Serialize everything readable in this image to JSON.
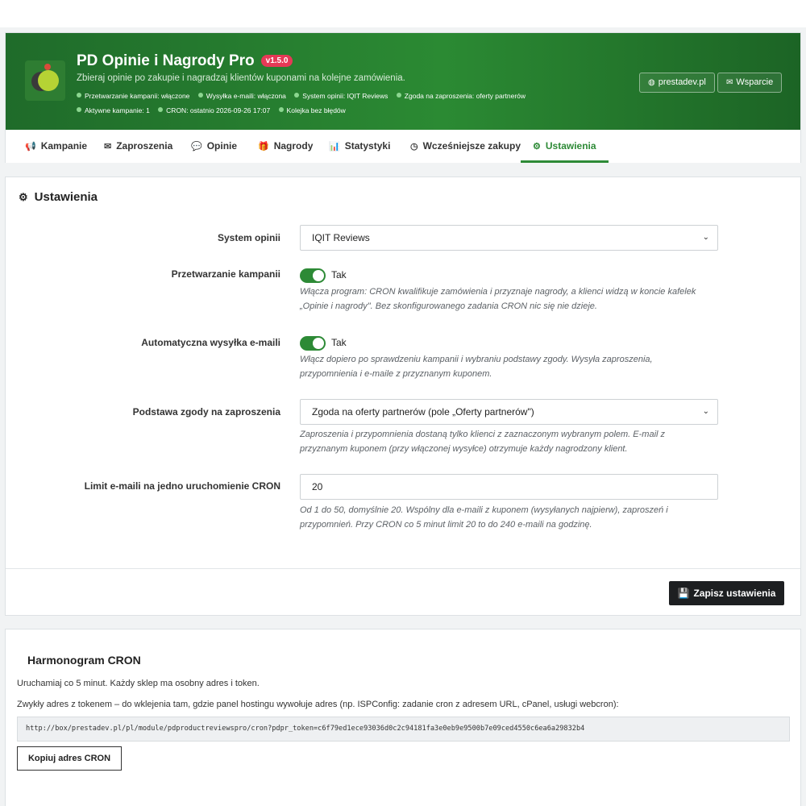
{
  "header": {
    "title": "PD Opinie i Nagrody Pro",
    "version": "v1.5.0",
    "subtitle": "Zbieraj opinie po zakupie i nagradzaj klientów kuponami na kolejne zamówienia.",
    "status_line1": [
      "Przetwarzanie kampanii: włączone",
      "Wysyłka e-maili: włączona",
      "System opinii: IQIT Reviews",
      "Zgoda na zaproszenia: oferty partnerów"
    ],
    "status_line2": [
      "Aktywne kampanie: 1",
      "CRON: ostatnio 2026-09-26 17:07",
      "Kolejka bez błędów"
    ],
    "site_button": "prestadev.pl",
    "support_button": "Wsparcie",
    "status_dot_color": "#8bd68f",
    "version_badge_color": "#e53956"
  },
  "tabs": [
    {
      "label": "Kampanie",
      "icon": "megaphone-icon"
    },
    {
      "label": "Zaproszenia",
      "icon": "envelope-icon"
    },
    {
      "label": "Opinie",
      "icon": "comments-icon"
    },
    {
      "label": "Nagrody",
      "icon": "gift-icon"
    },
    {
      "label": "Statystyki",
      "icon": "bar-chart-icon"
    },
    {
      "label": "Wcześniejsze zakupy",
      "icon": "history-icon"
    },
    {
      "label": "Ustawienia",
      "icon": "cogs-icon",
      "active": true
    }
  ],
  "settings": {
    "title": "Ustawienia",
    "review_system": {
      "label": "System opinii",
      "value": "IQIT Reviews"
    },
    "campaign_processing": {
      "label": "Przetwarzanie kampanii",
      "toggle": "Tak",
      "help_line1": "Włącza program: CRON kwalifikuje zamówienia i przyznaje nagrody, a klienci widzą w koncie kafelek",
      "help_line2": "„Opinie i nagrody\". Bez skonfigurowanego zadania CRON nic się nie dzieje."
    },
    "auto_email": {
      "label": "Automatyczna wysyłka e-maili",
      "toggle": "Tak",
      "help_line1": "Włącz dopiero po sprawdzeniu kampanii i wybraniu podstawy zgody. Wysyła zaproszenia,",
      "help_line2": "przypomnienia i e-maile z przyznanym kuponem."
    },
    "consent_basis": {
      "label": "Podstawa zgody na zaproszenia",
      "value": "Zgoda na oferty partnerów (pole „Oferty partnerów\")",
      "help_line1": "Zaproszenia i przypomnienia dostaną tylko klienci z zaznaczonym wybranym polem. E-mail z",
      "help_line2": "przyznanym kuponem (przy włączonej wysyłce) otrzymuje każdy nagrodzony klient."
    },
    "email_limit": {
      "label": "Limit e-maili na jedno uruchomienie CRON",
      "value": "20",
      "help_line1": "Od 1 do 50, domyślnie 20. Wspólny dla e-maili z kuponem (wysyłanych najpierw), zaproszeń i",
      "help_line2": "przypomnień. Przy CRON co 5 minut limit 20 to do 240 e-maili na godzinę."
    },
    "save_button": "Zapisz ustawienia",
    "toggle_color": "#2d8a36"
  },
  "cron": {
    "title": "Harmonogram CRON",
    "text1": "Uruchamiaj co 5 minut. Każdy sklep ma osobny adres i token.",
    "text2": "Zwykły adres z tokenem – do wklejenia tam, gdzie panel hostingu wywołuje adres (np. ISPConfig: zadanie cron z adresem URL, cPanel, usługi webcron):",
    "url": "http://box/prestadev.pl/pl/module/pdproductreviewspro/cron?pdpr_token=c6f79ed1ece93036d0c2c94181fa3e0eb9e9500b7e09ced4550c6ea6a29832b4",
    "copy_button": "Kopiuj adres CRON"
  }
}
